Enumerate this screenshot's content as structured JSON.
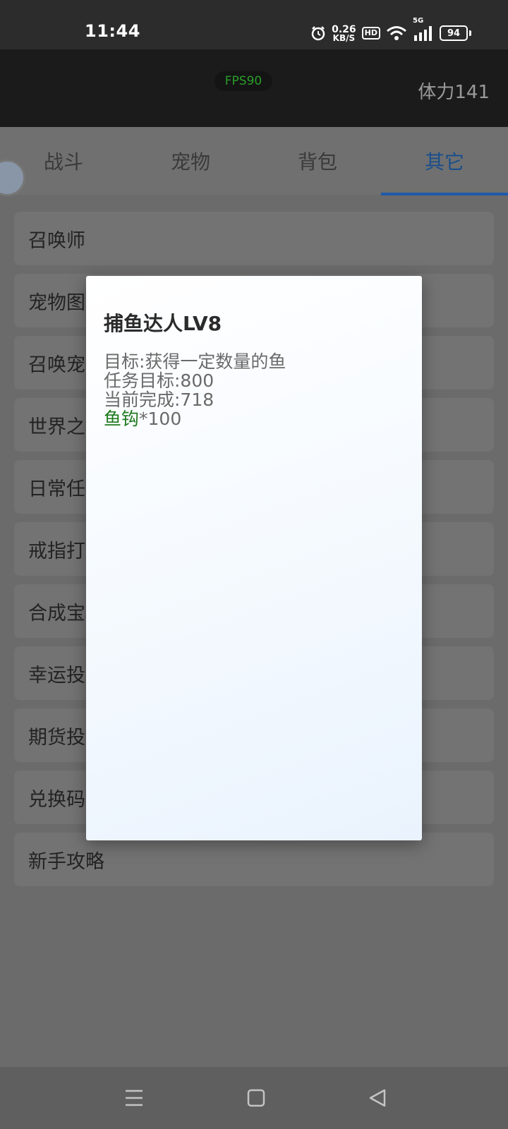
{
  "status_bar": {
    "time": "11:44",
    "net_speed_value": "0.26",
    "net_speed_unit": "KB/S",
    "hd_label": "HD",
    "network_label": "5G",
    "battery_level": "94"
  },
  "game_header": {
    "fps_label": "FPS90",
    "stamina": "体力141"
  },
  "tabs": [
    {
      "label": "战斗",
      "active": false
    },
    {
      "label": "宠物",
      "active": false
    },
    {
      "label": "背包",
      "active": false
    },
    {
      "label": "其它",
      "active": true
    }
  ],
  "menu_items": [
    {
      "label": "召唤师"
    },
    {
      "label": "宠物图"
    },
    {
      "label": "召唤宠"
    },
    {
      "label": "世界之"
    },
    {
      "label": "日常任"
    },
    {
      "label": "戒指打"
    },
    {
      "label": "合成宝"
    },
    {
      "label": "幸运投"
    },
    {
      "label": "期货投"
    },
    {
      "label": "兑换码"
    },
    {
      "label": "新手攻略"
    }
  ],
  "dialog": {
    "title": "捕鱼达人LV8",
    "goal": "目标:获得一定数量的鱼",
    "task_target": "任务目标:800",
    "current_progress": "当前完成:718",
    "reward_name": "鱼钩",
    "reward_qty": "*100"
  },
  "colors": {
    "accent": "#1e5aa8",
    "reward_green": "#1f7a1f",
    "fps_green": "#2a9d2a"
  }
}
